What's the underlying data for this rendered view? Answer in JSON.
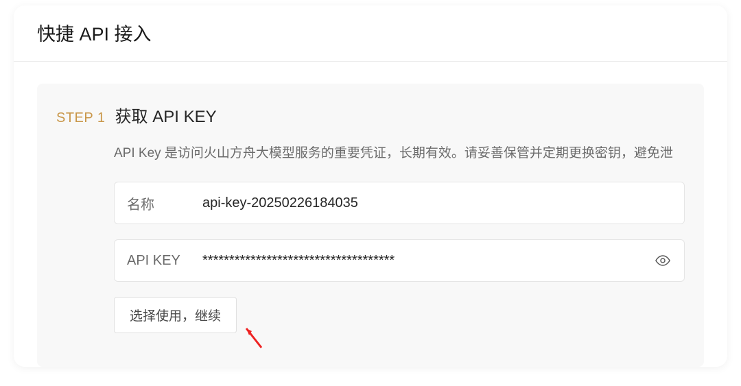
{
  "page": {
    "title": "快捷 API 接入"
  },
  "step1": {
    "label": "STEP 1",
    "title": "获取 API KEY",
    "description": "API Key 是访问火山方舟大模型服务的重要凭证，长期有效。请妥善保管并定期更换密钥，避免泄",
    "name_field": {
      "label": "名称",
      "value": "api-key-20250226184035"
    },
    "key_field": {
      "label": "API KEY",
      "value": "************************************"
    },
    "continue_button_label": "选择使用，继续"
  }
}
